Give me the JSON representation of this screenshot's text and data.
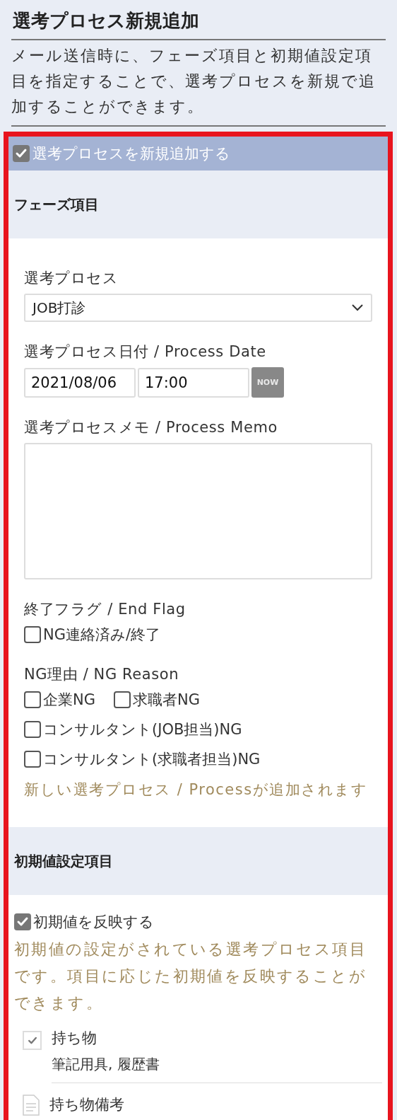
{
  "title": "選考プロセス新規追加",
  "description": "メール送信時に、フェーズ項目と初期値設定項目を指定することで、選考プロセスを新規で追加することができます。",
  "add_process": {
    "label": "選考プロセスを新規追加する",
    "checked": true
  },
  "phase_section": {
    "heading": "フェーズ項目",
    "process": {
      "label": "選考プロセス",
      "value": "JOB打診"
    },
    "date": {
      "label": "選考プロセス日付 / Process Date",
      "date": "2021/08/06",
      "time": "17:00",
      "now_button": "NOW"
    },
    "memo": {
      "label": "選考プロセスメモ / Process Memo"
    },
    "end_flag": {
      "label": "終了フラグ / End Flag",
      "options": [
        {
          "label": "NG連絡済み/終了",
          "checked": false
        }
      ]
    },
    "ng_reason": {
      "label": "NG理由 / NG Reason",
      "options": [
        {
          "label": "企業NG",
          "checked": false
        },
        {
          "label": "求職者NG",
          "checked": false
        },
        {
          "label": "コンサルタント(JOB担当)NG",
          "checked": false
        },
        {
          "label": "コンサルタント(求職者担当)NG",
          "checked": false
        }
      ]
    },
    "note": "新しい選考プロセス / Processが追加されます"
  },
  "initial_section": {
    "heading": "初期値設定項目",
    "reflect": {
      "label": "初期値を反映する",
      "checked": true
    },
    "note": "初期値の設定がされている選考プロセス項目です。項目に応じた初期値を反映することができます。",
    "items": [
      {
        "kind": "check",
        "label": "持ち物",
        "value": "筆記用具, 履歴書",
        "checked": true
      },
      {
        "kind": "memo",
        "label": "持ち物備考"
      }
    ]
  }
}
